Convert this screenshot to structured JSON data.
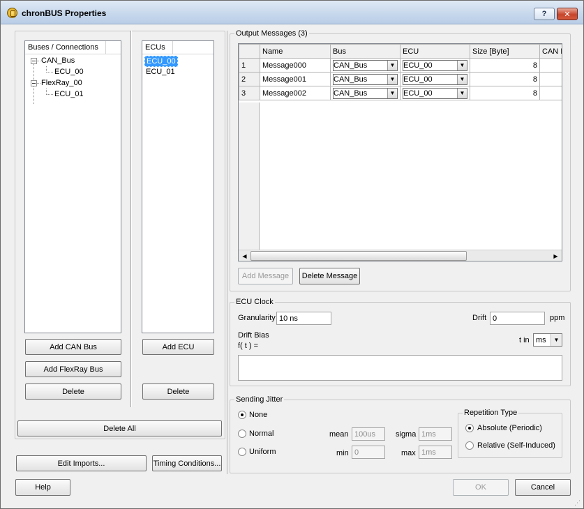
{
  "window": {
    "title": "chronBUS Properties",
    "help_glyph": "?",
    "close_glyph": "✕"
  },
  "left": {
    "buses_header": "Buses / Connections",
    "tree": [
      {
        "label": "CAN_Bus"
      },
      {
        "label": "ECU_00"
      },
      {
        "label": "FlexRay_00"
      },
      {
        "label": "ECU_01"
      }
    ],
    "add_can_bus": "Add CAN Bus",
    "add_flexray_bus": "Add FlexRay Bus",
    "delete_bus": "Delete",
    "ecus_header": "ECUs",
    "ecus": [
      "ECU_00",
      "ECU_01"
    ],
    "add_ecu": "Add ECU",
    "delete_ecu": "Delete",
    "delete_all": "Delete All",
    "edit_imports": "Edit Imports...",
    "timing_conditions": "Timing Conditions..."
  },
  "output_messages": {
    "group_label": "Output Messages (3)",
    "columns": [
      "",
      "Name",
      "Bus",
      "ECU",
      "Size [Byte]",
      "CAN II"
    ],
    "rows": [
      {
        "num": "1",
        "name": "Message000",
        "bus": "CAN_Bus",
        "ecu": "ECU_00",
        "size": "8"
      },
      {
        "num": "2",
        "name": "Message001",
        "bus": "CAN_Bus",
        "ecu": "ECU_00",
        "size": "8"
      },
      {
        "num": "3",
        "name": "Message002",
        "bus": "CAN_Bus",
        "ecu": "ECU_00",
        "size": "8"
      }
    ],
    "add_message": "Add Message",
    "delete_message": "Delete Message"
  },
  "ecu_clock": {
    "group_label": "ECU Clock",
    "granularity_label": "Granularity",
    "granularity_value": "10 ns",
    "drift_label": "Drift",
    "drift_value": "0",
    "drift_unit": "ppm",
    "drift_bias_label": "Drift Bias",
    "f_of_t_label": "f( t ) =",
    "t_in_label": "t in",
    "t_unit": "ms"
  },
  "sending_jitter": {
    "group_label": "Sending Jitter",
    "none_label": "None",
    "normal_label": "Normal",
    "uniform_label": "Uniform",
    "mean_label": "mean",
    "mean_value": "100us",
    "sigma_label": "sigma",
    "sigma_value": "1ms",
    "min_label": "min",
    "min_value": "0",
    "max_label": "max",
    "max_value": "1ms",
    "repetition_label": "Repetition Type",
    "absolute_label": "Absolute (Periodic)",
    "relative_label": "Relative (Self-Induced)"
  },
  "footer": {
    "help": "Help",
    "ok": "OK",
    "cancel": "Cancel"
  }
}
